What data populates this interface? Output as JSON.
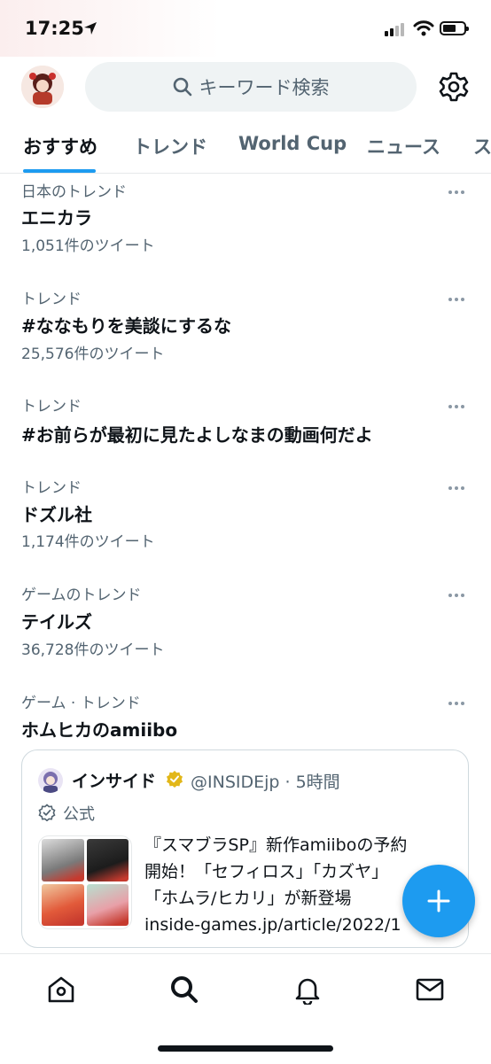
{
  "status_bar": {
    "time": "17:25"
  },
  "header": {
    "search_placeholder": "キーワード検索"
  },
  "tabs": [
    {
      "label": "おすすめ",
      "active": true
    },
    {
      "label": "トレンド"
    },
    {
      "label": "World Cup"
    },
    {
      "label": "ニュース"
    },
    {
      "label": "ス"
    }
  ],
  "trends": [
    {
      "category": "日本のトレンド",
      "title": "エニカラ",
      "count": "1,051件のツイート"
    },
    {
      "category": "トレンド",
      "title": "#ななもりを美談にするな",
      "count": "25,576件のツイート"
    },
    {
      "category": "トレンド",
      "title": "#お前らが最初に見たよしなまの動画何だよ",
      "count": ""
    },
    {
      "category": "トレンド",
      "title": "ドズル社",
      "count": "1,174件のツイート"
    },
    {
      "category": "ゲームのトレンド",
      "title": "テイルズ",
      "count": "36,728件のツイート"
    },
    {
      "category": "ゲーム · トレンド",
      "title": "ホムヒカのamiibo",
      "count": ""
    }
  ],
  "card": {
    "name": "インサイド",
    "handle": "@INSIDEjp · 5時間",
    "label": "公式",
    "text_lines": [
      "『スマブラSP』新作amiiboの予約",
      "開始！「セフィロス」「カズヤ」",
      "「ホムラ/ヒカリ」が新登場",
      "inside-games.jp/article/2022/1"
    ]
  },
  "colors": {
    "accent": "#1d9bf0",
    "text": "#0f1419",
    "secondary": "#536471",
    "verified": "#e2b719"
  },
  "icons": [
    "location-arrow-icon",
    "cellular-signal-icon",
    "wifi-icon",
    "battery-icon",
    "search-icon",
    "gear-icon",
    "more-icon",
    "verified-badge-icon",
    "official-check-icon",
    "plus-icon",
    "home-icon",
    "explore-icon",
    "bell-icon",
    "mail-icon"
  ]
}
